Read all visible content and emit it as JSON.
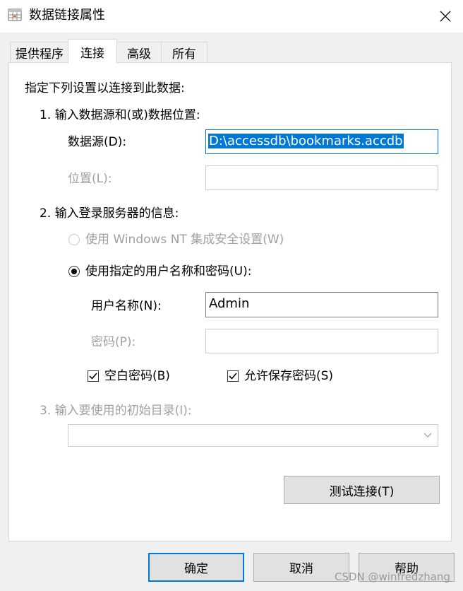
{
  "window": {
    "title": "数据链接属性",
    "close_label": "✕"
  },
  "tabs": [
    {
      "label": "提供程序"
    },
    {
      "label": "连接"
    },
    {
      "label": "高级"
    },
    {
      "label": "所有"
    }
  ],
  "connection": {
    "instruction": "指定下列设置以连接到此数据:",
    "step1_label": "1. 输入数据源和(或)数据位置:",
    "datasource_label": "数据源(D):",
    "datasource_value": "D:\\accessdb\\bookmarks.accdb",
    "location_label": "位置(L):",
    "location_value": "",
    "step2_label": "2. 输入登录服务器的信息:",
    "radio_windows_nt_label": "使用 Windows NT 集成安全设置(W)",
    "radio_specific_user_label": "使用指定的用户名称和密码(U):",
    "username_label": "用户名称(N):",
    "username_value": "Admin",
    "password_label": "密码(P):",
    "password_value": "",
    "blank_password_label": "空白密码(B)",
    "blank_password_checked": true,
    "allow_save_password_label": "允许保存密码(S)",
    "allow_save_password_checked": true,
    "step3_label": "3. 输入要使用的初始目录(I):",
    "initial_catalog_value": "",
    "test_connection_label": "测试连接(T)"
  },
  "footer": {
    "ok_label": "确定",
    "cancel_label": "取消",
    "help_label": "帮助",
    "watermark": "CSDN @winfredzhang"
  },
  "colors": {
    "accent": "#0078d7",
    "disabled_text": "#a0a0a0",
    "dialog_bg": "#f0f0f0"
  }
}
